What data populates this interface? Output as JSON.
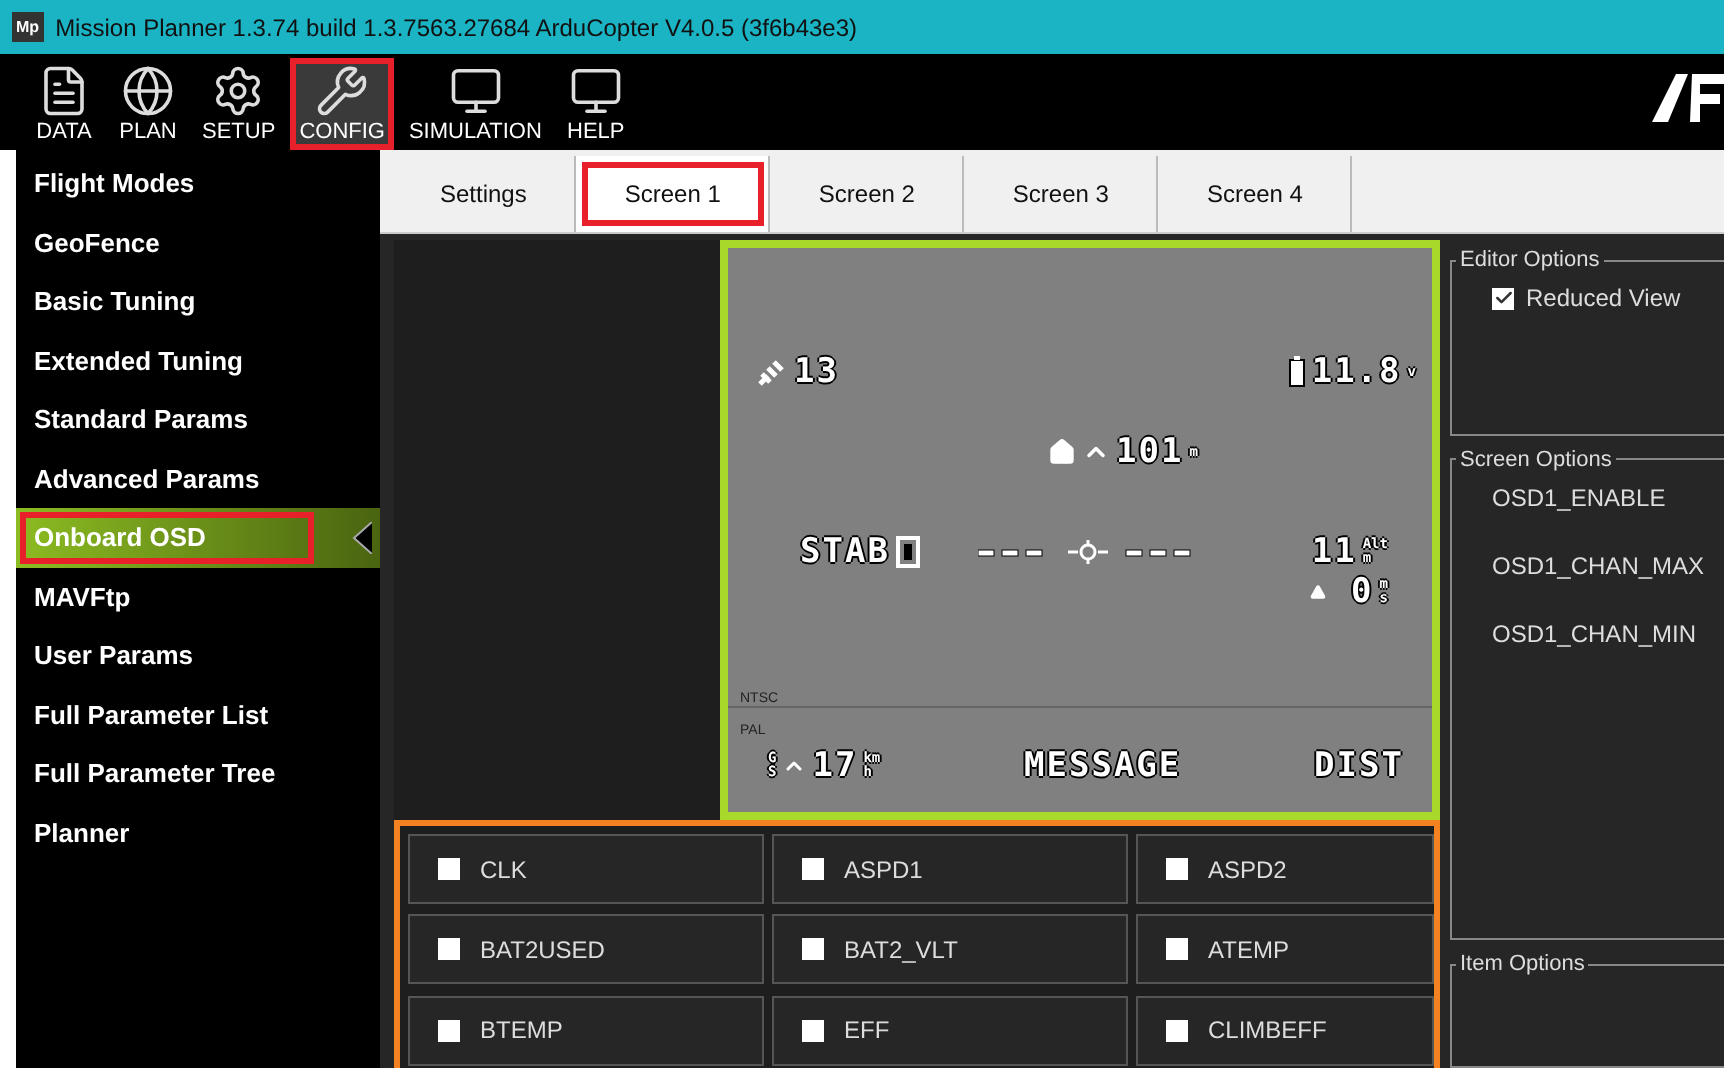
{
  "window": {
    "title": "Mission Planner 1.3.74 build 1.3.7563.27684 ArduCopter V4.0.5 (3f6b43e3)",
    "app_icon": "Mp"
  },
  "toolbar": [
    {
      "label": "DATA",
      "kind": "data",
      "selected": false,
      "highlighted": false
    },
    {
      "label": "PLAN",
      "kind": "plan",
      "selected": false,
      "highlighted": false
    },
    {
      "label": "SETUP",
      "kind": "setup",
      "selected": false,
      "highlighted": false
    },
    {
      "label": "CONFIG",
      "kind": "config",
      "selected": true,
      "highlighted": true
    },
    {
      "label": "SIMULATION",
      "kind": "simulation",
      "selected": false,
      "highlighted": false
    },
    {
      "label": "HELP",
      "kind": "help",
      "selected": false,
      "highlighted": false
    }
  ],
  "sidebar": {
    "items": [
      {
        "label": "Flight Modes",
        "selected": false,
        "highlighted": false
      },
      {
        "label": "GeoFence",
        "selected": false,
        "highlighted": false
      },
      {
        "label": "Basic Tuning",
        "selected": false,
        "highlighted": false
      },
      {
        "label": "Extended Tuning",
        "selected": false,
        "highlighted": false
      },
      {
        "label": "Standard Params",
        "selected": false,
        "highlighted": false
      },
      {
        "label": "Advanced Params",
        "selected": false,
        "highlighted": false
      },
      {
        "label": "Onboard OSD",
        "selected": true,
        "highlighted": true
      },
      {
        "label": "MAVFtp",
        "selected": false,
        "highlighted": false
      },
      {
        "label": "User Params",
        "selected": false,
        "highlighted": false
      },
      {
        "label": "Full Parameter List",
        "selected": false,
        "highlighted": false
      },
      {
        "label": "Full Parameter Tree",
        "selected": false,
        "highlighted": false
      },
      {
        "label": "Planner",
        "selected": false,
        "highlighted": false
      }
    ]
  },
  "tabs": [
    {
      "label": "Settings",
      "selected": false,
      "highlighted": false
    },
    {
      "label": "Screen 1",
      "selected": true,
      "highlighted": true
    },
    {
      "label": "Screen 2",
      "selected": false,
      "highlighted": false
    },
    {
      "label": "Screen 3",
      "selected": false,
      "highlighted": false
    },
    {
      "label": "Screen 4",
      "selected": false,
      "highlighted": false
    }
  ],
  "osd": {
    "ntsc_label": "NTSC",
    "pal_label": "PAL",
    "elements": [
      {
        "kind": "sats",
        "text": "13"
      },
      {
        "kind": "battery",
        "text": "11.8",
        "unit": [
          "v"
        ]
      },
      {
        "kind": "home",
        "text": "101",
        "unit": [
          "m"
        ]
      },
      {
        "kind": "mode",
        "text": "STAB"
      },
      {
        "kind": "horizon"
      },
      {
        "kind": "alt",
        "text": "11",
        "unit": [
          "Alt",
          "m"
        ]
      },
      {
        "kind": "climb",
        "text": "0",
        "unit": [
          "m",
          "s"
        ]
      },
      {
        "kind": "gs",
        "prefix": [
          "G",
          "S"
        ],
        "text": "17",
        "unit": [
          "km",
          "h"
        ]
      },
      {
        "kind": "message",
        "text": "MESSAGE"
      },
      {
        "kind": "dist",
        "text": "DIST"
      }
    ]
  },
  "items": [
    {
      "label": "CLK",
      "checked": false
    },
    {
      "label": "ASPD1",
      "checked": false
    },
    {
      "label": "ASPD2",
      "checked": false
    },
    {
      "label": "BAT2USED",
      "checked": false
    },
    {
      "label": "BAT2_VLT",
      "checked": false
    },
    {
      "label": "ATEMP",
      "checked": false
    },
    {
      "label": "BTEMP",
      "checked": false
    },
    {
      "label": "EFF",
      "checked": false
    },
    {
      "label": "CLIMBEFF",
      "checked": false
    }
  ],
  "editor_options": {
    "title": "Editor Options",
    "reduced_view": {
      "label": "Reduced View",
      "checked": true
    }
  },
  "screen_options": {
    "title": "Screen Options",
    "params": [
      "OSD1_ENABLE",
      "OSD1_CHAN_MAX",
      "OSD1_CHAN_MIN"
    ]
  },
  "item_options": {
    "title": "Item Options"
  }
}
